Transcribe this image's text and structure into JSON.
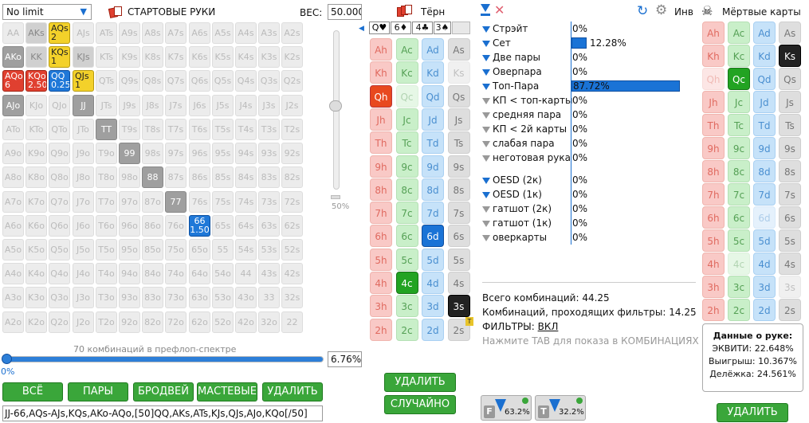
{
  "left": {
    "limit_select": "No limit",
    "title": "СТАРТОВЫЕ РУКИ",
    "weight_label": "ВЕС:",
    "weight_value": "50.000",
    "slider_pct": "50%",
    "hands": [
      [
        "AA",
        "AKs",
        "AQs",
        "AJs",
        "ATs",
        "A9s",
        "A8s",
        "A7s",
        "A6s",
        "A5s",
        "A4s",
        "A3s",
        "A2s"
      ],
      [
        "AKo",
        "KK",
        "KQs",
        "KJs",
        "KTs",
        "K9s",
        "K8s",
        "K7s",
        "K6s",
        "K5s",
        "K4s",
        "K3s",
        "K2s"
      ],
      [
        "AQo",
        "KQo",
        "QQ",
        "QJs",
        "QTs",
        "Q9s",
        "Q8s",
        "Q7s",
        "Q6s",
        "Q5s",
        "Q4s",
        "Q3s",
        "Q2s"
      ],
      [
        "AJo",
        "KJo",
        "QJo",
        "JJ",
        "JTs",
        "J9s",
        "J8s",
        "J7s",
        "J6s",
        "J5s",
        "J4s",
        "J3s",
        "J2s"
      ],
      [
        "ATo",
        "KTo",
        "QTo",
        "JTo",
        "TT",
        "T9s",
        "T8s",
        "T7s",
        "T6s",
        "T5s",
        "T4s",
        "T3s",
        "T2s"
      ],
      [
        "A9o",
        "K9o",
        "Q9o",
        "J9o",
        "T9o",
        "99",
        "98s",
        "97s",
        "96s",
        "95s",
        "94s",
        "93s",
        "92s"
      ],
      [
        "A8o",
        "K8o",
        "Q8o",
        "J8o",
        "T8o",
        "98o",
        "88",
        "87s",
        "86s",
        "85s",
        "84s",
        "83s",
        "82s"
      ],
      [
        "A7o",
        "K7o",
        "Q7o",
        "J7o",
        "T7o",
        "97o",
        "87o",
        "77",
        "76s",
        "75s",
        "74s",
        "73s",
        "72s"
      ],
      [
        "A6o",
        "K6o",
        "Q6o",
        "J6o",
        "T6o",
        "96o",
        "86o",
        "76o",
        "66",
        "65s",
        "64s",
        "63s",
        "62s"
      ],
      [
        "A5o",
        "K5o",
        "Q5o",
        "J5o",
        "T5o",
        "95o",
        "85o",
        "75o",
        "65o",
        "55",
        "54s",
        "53s",
        "52s"
      ],
      [
        "A4o",
        "K4o",
        "Q4o",
        "J4o",
        "T4o",
        "94o",
        "84o",
        "74o",
        "64o",
        "54o",
        "44",
        "43s",
        "42s"
      ],
      [
        "A3o",
        "K3o",
        "Q3o",
        "J3o",
        "T3o",
        "93o",
        "83o",
        "73o",
        "63o",
        "53o",
        "43o",
        "33",
        "32s"
      ],
      [
        "A2o",
        "K2o",
        "Q2o",
        "J2o",
        "T2o",
        "92o",
        "82o",
        "72o",
        "62o",
        "52o",
        "42o",
        "32o",
        "22"
      ]
    ],
    "special": {
      "AQs": {
        "style": "yellow",
        "value": "2"
      },
      "KQs": {
        "style": "yellow",
        "value": "1"
      },
      "QJs": {
        "style": "yellow",
        "value": "1"
      },
      "AQo": {
        "style": "red",
        "value": "6"
      },
      "KQo": {
        "style": "red",
        "value": "2.50"
      },
      "QQ": {
        "style": "blue",
        "value": "0.25"
      },
      "66": {
        "style": "sel6",
        "value": "1.50"
      },
      "AKs": {
        "style": "gray2"
      },
      "AKo": {
        "style": "gray"
      },
      "KK": {
        "style": "gray2"
      },
      "KJs": {
        "style": "gray2"
      },
      "AJo": {
        "style": "gray"
      },
      "JJ": {
        "style": "gray"
      },
      "TT": {
        "style": "gray"
      },
      "99": {
        "style": "gray"
      },
      "88": {
        "style": "gray"
      },
      "77": {
        "style": "gray"
      }
    },
    "combos_label": "70 комбинаций в префлоп-спектре",
    "range_pct": "6.76%",
    "range_slider_pct": "0%",
    "buttons": [
      "ВСЁ",
      "ПАРЫ",
      "БРОДВЕЙ",
      "МАСТЕВЫЕ",
      "УДАЛИТЬ"
    ],
    "range_text": "JJ-66,AQs-AJs,KQs,AKo-AQo,[50]QQ,AKs,ATs,KJs,QJs,AJo,KQo[/50]"
  },
  "turn": {
    "title": "Тёрн",
    "board": [
      "Q♥",
      "6♦",
      "4♣",
      "3♠"
    ],
    "delete": "УДАЛИТЬ",
    "random": "СЛУЧАЙНО"
  },
  "filters": {
    "items": [
      {
        "name": "Стрэйт",
        "pct": "0%",
        "active": true,
        "bar": 0
      },
      {
        "name": "Сет",
        "pct": "12.28%",
        "active": true,
        "bar": 12.28
      },
      {
        "name": "Две пары",
        "pct": "0%",
        "active": true,
        "bar": 0
      },
      {
        "name": "Оверпара",
        "pct": "0%",
        "active": true,
        "bar": 0
      },
      {
        "name": "Топ-Пара",
        "pct": "87.72%",
        "active": true,
        "bar": 87.72
      },
      {
        "name": "КП < топ-карты",
        "pct": "0%",
        "active": false,
        "bar": 0
      },
      {
        "name": "средняя пара",
        "pct": "0%",
        "active": false,
        "bar": 0
      },
      {
        "name": "КП < 2й карты",
        "pct": "0%",
        "active": false,
        "bar": 0
      },
      {
        "name": "слабая пара",
        "pct": "0%",
        "active": false,
        "bar": 0
      },
      {
        "name": "неготовая рука",
        "pct": "0%",
        "active": false,
        "bar": 0
      }
    ],
    "draws": [
      {
        "name": "OESD (2к)",
        "pct": "0%",
        "active": true
      },
      {
        "name": "OESD (1к)",
        "pct": "0%",
        "active": true
      },
      {
        "name": "гатшот (2к)",
        "pct": "0%",
        "active": false
      },
      {
        "name": "гатшот (1к)",
        "pct": "0%",
        "active": false
      },
      {
        "name": "оверкарты",
        "pct": "0%",
        "active": false
      }
    ],
    "total_combos": "Всего комбинаций: 44.25",
    "pass_combos": "Комбинаций, проходящих фильтры: 14.25",
    "filters_label": "ФИЛЬТРЫ:",
    "filters_state": "ВКЛ",
    "tab_hint": "Нажмите TAB для показа в КОМБИНАЦИЯХ",
    "f_pct": "63.2%",
    "t_pct": "32.2%",
    "inv_label": "Инв"
  },
  "dead": {
    "title": "Мёртвые карты",
    "hand_title": "Данные о руке:",
    "equity": "ЭКВИТИ: 22.648%",
    "win": "Выигрыш: 10.367%",
    "tie": "Делёжка: 24.561%",
    "delete": "УДАЛИТЬ"
  },
  "colors": {
    "accent": "#1a73d6",
    "green": "#3aa63a"
  }
}
